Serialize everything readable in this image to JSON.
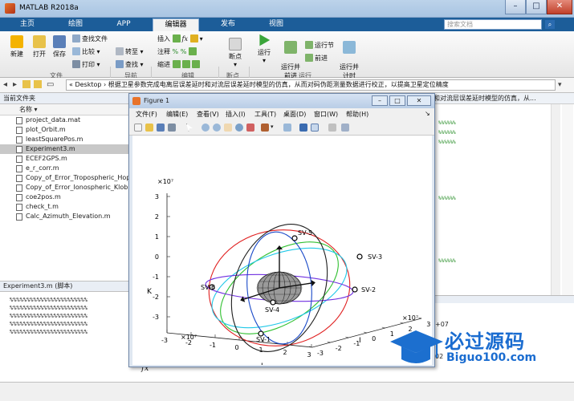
{
  "app": {
    "title": "MATLAB R2018a"
  },
  "window_controls": {
    "minimize": "–",
    "maximize": "□",
    "close": "✕"
  },
  "tabs": [
    {
      "label": "主页"
    },
    {
      "label": "绘图"
    },
    {
      "label": "APP"
    },
    {
      "label": "编辑器"
    },
    {
      "label": "发布"
    },
    {
      "label": "视图"
    }
  ],
  "search": {
    "placeholder": "搜索文档"
  },
  "toolstrip": {
    "new": "新建",
    "open": "打开",
    "save": "保存",
    "find_files": "查找文件",
    "compare": "比较",
    "print": "打印",
    "goto": "转至",
    "find": "查找",
    "insert": "插入",
    "comment": "注释",
    "indent": "缩进",
    "breakpoints": "断点",
    "run": "运行",
    "run_advance": "运行并\n前进",
    "run_section": "运行节",
    "advance": "前进",
    "run_time": "运行并\n计时",
    "groups": {
      "file": "文件",
      "navigate": "导航",
      "edit": "编辑",
      "breakpoints": "断点",
      "run": "运行"
    }
  },
  "address": {
    "path": "« Desktop › 根据卫星参数完成电离层误差延时和对流层误差延时模型的仿真，从而对码伪距测量数据进行校正，以提高卫星定位精度"
  },
  "current_folder": {
    "header": "当前文件夹",
    "column": "名称 ▾",
    "files": [
      {
        "name": "project_data.mat",
        "selected": false
      },
      {
        "name": "plot_Orbit.m",
        "selected": false
      },
      {
        "name": "leastSquarePos.m",
        "selected": false
      },
      {
        "name": "Experiment3.m",
        "selected": true
      },
      {
        "name": "ECEF2GPS.m",
        "selected": false
      },
      {
        "name": "e_r_corr.m",
        "selected": false
      },
      {
        "name": "Copy_of_Error_Tropospheric_Hop",
        "selected": false
      },
      {
        "name": "Copy_of_Error_Ionospheric_Klobu",
        "selected": false
      },
      {
        "name": "coe2pos.m",
        "selected": false
      },
      {
        "name": "check_t.m",
        "selected": false
      },
      {
        "name": "Calc_Azimuth_Elevation.m",
        "selected": false
      }
    ]
  },
  "details": {
    "header": "Experiment3.m (脚本)",
    "lines": [
      "%%%%%%%%%%%%%%%%%%%%%%%",
      "%%%%%%%%%%%%%%%%%%%%%%%",
      "%%%%%%%%%%%%%%%%%%%%%%%",
      "%%%%%%%%%%%%%%%%%%%%%%%",
      "%%%%%%%%%%%%%%%%%%%%%%%"
    ]
  },
  "editor_right": {
    "header_text": "和对流层误差延时模型的仿真，从...",
    "pct": "%%%%%%",
    "exp1": "+07",
    "exp2": "02"
  },
  "figure": {
    "title": "Figure 1",
    "menu": [
      "文件(F)",
      "编辑(E)",
      "查看(V)",
      "插入(I)",
      "工具(T)",
      "桌面(D)",
      "窗口(W)",
      "帮助(H)"
    ],
    "controls": {
      "minimize": "–",
      "maximize": "□",
      "close": "✕"
    }
  },
  "chart_data": {
    "type": "scatter",
    "title": "",
    "xlabel": "J",
    "ylabel": "I",
    "zlabel": "K",
    "x_ticks": [
      "-3",
      "-2",
      "-1",
      "0",
      "1",
      "2",
      "3"
    ],
    "y_ticks": [
      "-3",
      "-2",
      "-1",
      "0",
      "1",
      "2",
      "3"
    ],
    "z_ticks": [
      "3",
      "2",
      "1",
      "0",
      "-1",
      "-2",
      "-3"
    ],
    "x_exponent": "×10⁷",
    "y_exponent": "×10⁷",
    "z_exponent": "×10⁷",
    "satellites": [
      {
        "name": "SV-1"
      },
      {
        "name": "SV-2"
      },
      {
        "name": "SV-3"
      },
      {
        "name": "SV-4"
      },
      {
        "name": "SV-5"
      },
      {
        "name": "SV-6"
      }
    ],
    "orbit_colors": [
      "#e02020",
      "#30c030",
      "#20c8e8",
      "#7030e0",
      "#202020",
      "#1848c8"
    ],
    "grid": false
  },
  "watermark": {
    "brand": "必过源码",
    "url": "Biguo100.com"
  },
  "command": {
    "fx": "fx"
  }
}
